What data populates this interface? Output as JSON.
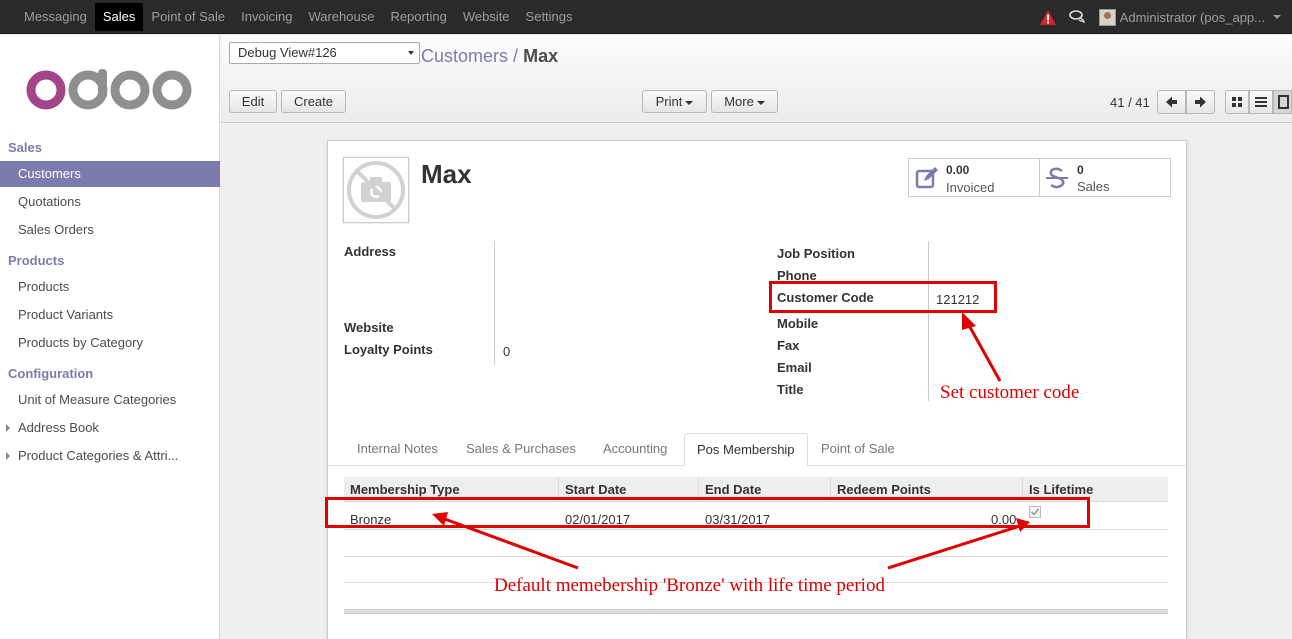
{
  "topbar": {
    "menu": [
      "Messaging",
      "Sales",
      "Point of Sale",
      "Invoicing",
      "Warehouse",
      "Reporting",
      "Website",
      "Settings"
    ],
    "active_menu": "Sales",
    "user": "Administrator (pos_app..."
  },
  "sidebar": {
    "logo": "odoo",
    "sections": [
      {
        "title": "Sales",
        "items": [
          "Customers",
          "Quotations",
          "Sales Orders"
        ]
      },
      {
        "title": "Products",
        "items": [
          "Products",
          "Product Variants",
          "Products by Category"
        ]
      },
      {
        "title": "Configuration",
        "items": [
          "Unit of Measure Categories",
          "Address Book",
          "Product Categories & Attri..."
        ]
      }
    ],
    "active_item": "Customers"
  },
  "control_panel": {
    "debug_select": "Debug View#126",
    "breadcrumb_parent": "Customers",
    "breadcrumb_sep": "/",
    "breadcrumb_current": "Max",
    "edit": "Edit",
    "create": "Create",
    "print": "Print",
    "more": "More",
    "pager": "41 / 41"
  },
  "form": {
    "name": "Max",
    "stats": [
      {
        "value": "0.00",
        "label": "Invoiced",
        "icon": "pencil-square-icon"
      },
      {
        "value": "0",
        "label": "Sales",
        "icon": "strikethrough-icon"
      }
    ],
    "left_fields": {
      "address_label": "Address",
      "website_label": "Website",
      "loyalty_label": "Loyalty Points",
      "loyalty_value": "0"
    },
    "right_fields": {
      "job_position": "Job Position",
      "phone": "Phone",
      "customer_code_label": "Customer Code",
      "customer_code_value": "121212",
      "mobile": "Mobile",
      "fax": "Fax",
      "email": "Email",
      "title": "Title"
    },
    "tabs": [
      "Internal Notes",
      "Sales & Purchases",
      "Accounting",
      "Pos Membership",
      "Point of Sale"
    ],
    "active_tab": "Pos Membership",
    "membership_table": {
      "columns": [
        "Membership Type",
        "Start Date",
        "End Date",
        "Redeem Points",
        "Is Lifetime"
      ],
      "rows": [
        {
          "type": "Bronze",
          "start": "02/01/2017",
          "end": "03/31/2017",
          "points": "0.00",
          "lifetime": true
        }
      ]
    }
  },
  "annotations": {
    "customer_code_note": "Set customer code",
    "membership_note": "Default memebership 'Bronze' with life time period",
    "color": "#e00000"
  },
  "colors": {
    "accent": "#7c7bad",
    "topbar": "#2a2a2a",
    "logo_pink": "#a24689",
    "logo_grey": "#8f8f8f"
  }
}
